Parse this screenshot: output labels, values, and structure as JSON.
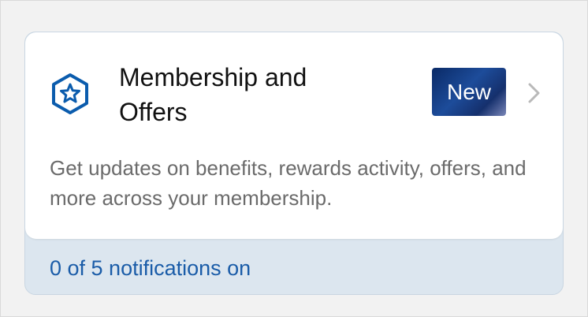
{
  "card": {
    "title": "Membership and Offers",
    "badge": "New",
    "description": "Get updates on benefits, rewards activity, offers, and more across your membership.",
    "notifications_status": "0 of 5 notifications on",
    "icon": "star-hexagon-icon",
    "chevron_icon": "chevron-right-icon"
  },
  "colors": {
    "accent": "#1a5ca8",
    "icon_blue": "#0b5cad",
    "badge_dark": "#0a2a66",
    "footer_bg": "#dce6ef"
  }
}
